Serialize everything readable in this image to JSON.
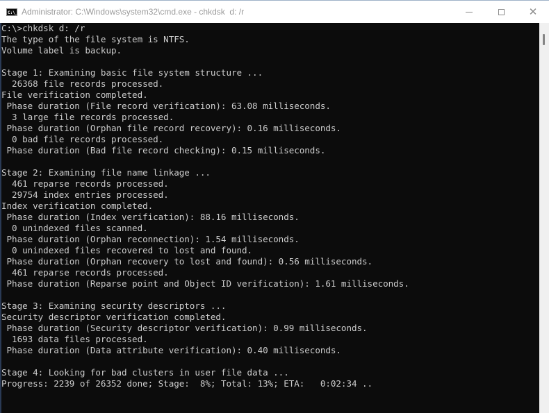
{
  "window": {
    "title": "Administrator: C:\\Windows\\system32\\cmd.exe - chkdsk  d: /r",
    "app_icon": "cmd-icon",
    "app_icon_label": "C:\\_",
    "controls": {
      "minimize": "minimize-icon",
      "maximize": "maximize-icon",
      "close": "close-icon",
      "close_glyph": "✕"
    }
  },
  "console": {
    "lines": [
      "C:\\>chkdsk d: /r",
      "The type of the file system is NTFS.",
      "Volume label is backup.",
      "",
      "Stage 1: Examining basic file system structure ...",
      "  26368 file records processed.",
      "File verification completed.",
      " Phase duration (File record verification): 63.08 milliseconds.",
      "  3 large file records processed.",
      " Phase duration (Orphan file record recovery): 0.16 milliseconds.",
      "  0 bad file records processed.",
      " Phase duration (Bad file record checking): 0.15 milliseconds.",
      "",
      "Stage 2: Examining file name linkage ...",
      "  461 reparse records processed.",
      "  29754 index entries processed.",
      "Index verification completed.",
      " Phase duration (Index verification): 88.16 milliseconds.",
      "  0 unindexed files scanned.",
      " Phase duration (Orphan reconnection): 1.54 milliseconds.",
      "  0 unindexed files recovered to lost and found.",
      " Phase duration (Orphan recovery to lost and found): 0.56 milliseconds.",
      "  461 reparse records processed.",
      " Phase duration (Reparse point and Object ID verification): 1.61 milliseconds.",
      "",
      "Stage 3: Examining security descriptors ...",
      "Security descriptor verification completed.",
      " Phase duration (Security descriptor verification): 0.99 milliseconds.",
      "  1693 data files processed.",
      " Phase duration (Data attribute verification): 0.40 milliseconds.",
      "",
      "Stage 4: Looking for bad clusters in user file data ...",
      "Progress: 2239 of 26352 done; Stage:  8%; Total: 13%; ETA:   0:02:34 .."
    ]
  },
  "scrollbar": {
    "position_fraction": 0.0
  }
}
